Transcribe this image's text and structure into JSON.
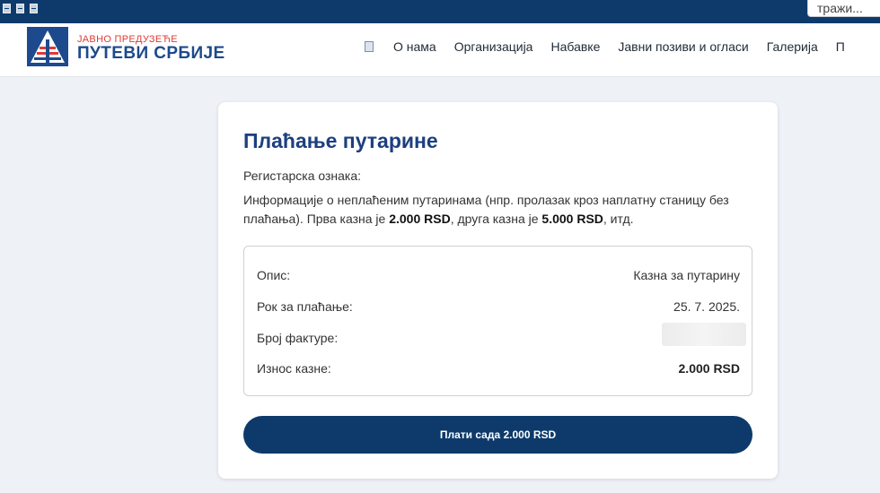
{
  "topbar": {
    "search_placeholder": "тражи..."
  },
  "header": {
    "logo_top": "ЈАВНО ПРЕДУЗЕЋЕ",
    "logo_bottom": "ПУТЕВИ СРБИЈЕ",
    "nav": [
      "О нама",
      "Организација",
      "Набавке",
      "Јавни позиви и огласи",
      "Галерија",
      "П"
    ]
  },
  "card": {
    "title": "Плаћање путарине",
    "reg_label": "Регистарска ознака:",
    "info_part1": "Информације о неплаћеним путаринама (нпр. пролазак кроз наплатну станицу без плаћања). Прва казна је ",
    "fine1": "2.000 RSD",
    "info_part2": ", друга казна је ",
    "fine2": "5.000 RSD",
    "info_part3": ", итд.",
    "details": {
      "desc_label": "Опис:",
      "desc_value": "Казна за путарину",
      "due_label": "Рок за плаћање:",
      "due_value": "25. 7. 2025.",
      "invoice_label": "Број фактуре:",
      "amount_label": "Износ казне:",
      "amount_value": "2.000 RSD"
    },
    "pay_button": "Плати сада 2.000 RSD"
  },
  "colors": {
    "primary": "#0d3a6b",
    "title": "#1d3f7f",
    "logo_red": "#e03a36",
    "logo_blue": "#1d4a8c"
  }
}
